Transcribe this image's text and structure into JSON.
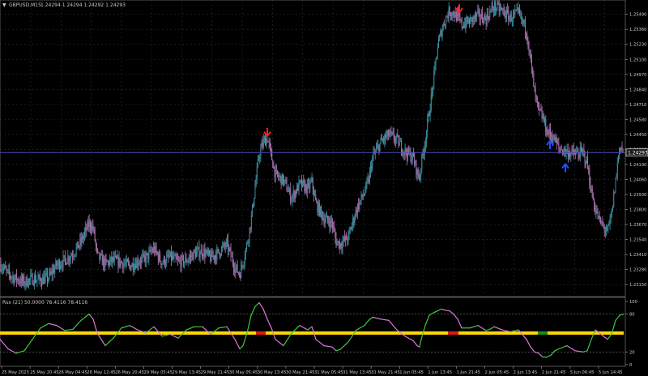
{
  "main": {
    "title_marker": "▼",
    "symbol": "GBPUSD,M15",
    "ohlc": "1.24294 1.24294 1.24292 1.24293",
    "current_price": "1.24293",
    "price_labels": [
      "1.25490",
      "1.25360",
      "1.25230",
      "1.25100",
      "1.24970",
      "1.24840",
      "1.24710",
      "1.24580",
      "1.24450",
      "1.24320",
      "1.24190",
      "1.24060",
      "1.23930",
      "1.23800",
      "1.23670",
      "1.23540",
      "1.23410",
      "1.23280",
      "1.23150"
    ]
  },
  "indicator": {
    "title": "Rsx (21) 50.0000 78.4116 78.4116",
    "levels": [
      "100",
      "80",
      "20",
      "0"
    ]
  },
  "time_axis": {
    "labels": [
      "25 May 2023",
      "25 May 20:45",
      "26 May 04:45",
      "26 May 12:45",
      "26 May 20:45",
      "29 May 05:45",
      "29 May 13:45",
      "29 May 21:45",
      "30 May 05:45",
      "30 May 13:45",
      "30 May 21:45",
      "31 May 05:45",
      "31 May 13:45",
      "31 May 21:45",
      "1 Jun 05:45",
      "1 Jun 13:45",
      "1 Jun 21:45",
      "2 Jun 05:45",
      "2 Jun 13:45",
      "2 Jun 21:45",
      "5 Jun 06:45",
      "5 Jun 14:45"
    ]
  },
  "colors": {
    "background": "#000000",
    "grid": "#2a2a3e",
    "bull_candle": "#3a8c9c",
    "bear_candle": "#a870a8",
    "rsx_up": "#3ec83e",
    "rsx_down": "#d87ad8",
    "midline": "#ffd700",
    "sell_arrow": "#ff2020",
    "buy_arrow": "#1e50ff",
    "current_price_line": "#4a4ab8"
  },
  "chart_data": {
    "type": "line",
    "symbol": "GBPUSD",
    "timeframe": "M15",
    "y_range": [
      1.2306,
      1.256
    ],
    "close_path": [
      [
        0,
        1.2333
      ],
      [
        10,
        1.2324
      ],
      [
        20,
        1.232
      ],
      [
        30,
        1.2317
      ],
      [
        40,
        1.232
      ],
      [
        50,
        1.2319
      ],
      [
        60,
        1.2321
      ],
      [
        70,
        1.2332
      ],
      [
        80,
        1.2336
      ],
      [
        90,
        1.2342
      ],
      [
        100,
        1.2352
      ],
      [
        110,
        1.2368
      ],
      [
        115,
        1.2364
      ],
      [
        120,
        1.234
      ],
      [
        130,
        1.2333
      ],
      [
        140,
        1.2336
      ],
      [
        150,
        1.2334
      ],
      [
        160,
        1.2331
      ],
      [
        170,
        1.2335
      ],
      [
        180,
        1.2338
      ],
      [
        190,
        1.2346
      ],
      [
        200,
        1.2334
      ],
      [
        210,
        1.2339
      ],
      [
        220,
        1.2334
      ],
      [
        230,
        1.2336
      ],
      [
        240,
        1.2342
      ],
      [
        250,
        1.2344
      ],
      [
        260,
        1.2338
      ],
      [
        270,
        1.2343
      ],
      [
        280,
        1.235
      ],
      [
        290,
        1.233
      ],
      [
        296,
        1.2324
      ],
      [
        300,
        1.2335
      ],
      [
        305,
        1.235
      ],
      [
        310,
        1.2371
      ],
      [
        315,
        1.24
      ],
      [
        320,
        1.2428
      ],
      [
        325,
        1.2438
      ],
      [
        330,
        1.2442
      ],
      [
        335,
        1.2426
      ],
      [
        340,
        1.241
      ],
      [
        350,
        1.2405
      ],
      [
        360,
        1.239
      ],
      [
        370,
        1.2402
      ],
      [
        380,
        1.2398
      ],
      [
        385,
        1.2404
      ],
      [
        390,
        1.2385
      ],
      [
        400,
        1.2372
      ],
      [
        410,
        1.2368
      ],
      [
        415,
        1.2352
      ],
      [
        420,
        1.235
      ],
      [
        430,
        1.2356
      ],
      [
        440,
        1.238
      ],
      [
        450,
        1.2395
      ],
      [
        455,
        1.2405
      ],
      [
        460,
        1.2425
      ],
      [
        470,
        1.2438
      ],
      [
        480,
        1.2445
      ],
      [
        490,
        1.244
      ],
      [
        500,
        1.243
      ],
      [
        510,
        1.2425
      ],
      [
        515,
        1.2412
      ],
      [
        518,
        1.2407
      ],
      [
        520,
        1.242
      ],
      [
        525,
        1.244
      ],
      [
        530,
        1.2465
      ],
      [
        535,
        1.249
      ],
      [
        540,
        1.252
      ],
      [
        545,
        1.2535
      ],
      [
        550,
        1.2545
      ],
      [
        555,
        1.2552
      ],
      [
        560,
        1.255
      ],
      [
        565,
        1.2546
      ],
      [
        570,
        1.254
      ],
      [
        580,
        1.2543
      ],
      [
        590,
        1.2548
      ],
      [
        600,
        1.2545
      ],
      [
        605,
        1.2551
      ],
      [
        610,
        1.2556
      ],
      [
        620,
        1.2552
      ],
      [
        630,
        1.2546
      ],
      [
        640,
        1.255
      ],
      [
        650,
        1.2535
      ],
      [
        655,
        1.251
      ],
      [
        660,
        1.248
      ],
      [
        665,
        1.2465
      ],
      [
        670,
        1.246
      ],
      [
        675,
        1.2448
      ],
      [
        680,
        1.2445
      ],
      [
        685,
        1.244
      ],
      [
        690,
        1.2433
      ],
      [
        700,
        1.243
      ],
      [
        710,
        1.2428
      ],
      [
        720,
        1.2429
      ],
      [
        725,
        1.242
      ],
      [
        730,
        1.2395
      ],
      [
        735,
        1.238
      ],
      [
        740,
        1.237
      ],
      [
        745,
        1.2365
      ],
      [
        750,
        1.236
      ],
      [
        755,
        1.2375
      ],
      [
        760,
        1.2405
      ],
      [
        765,
        1.2436
      ],
      [
        770,
        1.243
      ]
    ],
    "rsx_path": [
      [
        0,
        40
      ],
      [
        10,
        25
      ],
      [
        20,
        18
      ],
      [
        30,
        22
      ],
      [
        40,
        40
      ],
      [
        50,
        58
      ],
      [
        60,
        65
      ],
      [
        70,
        62
      ],
      [
        80,
        54
      ],
      [
        90,
        56
      ],
      [
        100,
        70
      ],
      [
        110,
        80
      ],
      [
        115,
        72
      ],
      [
        120,
        50
      ],
      [
        130,
        30
      ],
      [
        140,
        42
      ],
      [
        150,
        58
      ],
      [
        160,
        62
      ],
      [
        170,
        55
      ],
      [
        180,
        50
      ],
      [
        190,
        60
      ],
      [
        200,
        45
      ],
      [
        210,
        48
      ],
      [
        220,
        42
      ],
      [
        230,
        55
      ],
      [
        240,
        60
      ],
      [
        250,
        60
      ],
      [
        260,
        48
      ],
      [
        270,
        58
      ],
      [
        280,
        60
      ],
      [
        290,
        40
      ],
      [
        296,
        25
      ],
      [
        300,
        30
      ],
      [
        305,
        50
      ],
      [
        310,
        78
      ],
      [
        315,
        92
      ],
      [
        320,
        98
      ],
      [
        325,
        88
      ],
      [
        330,
        72
      ],
      [
        335,
        58
      ],
      [
        340,
        40
      ],
      [
        350,
        30
      ],
      [
        360,
        50
      ],
      [
        370,
        62
      ],
      [
        380,
        55
      ],
      [
        385,
        60
      ],
      [
        390,
        40
      ],
      [
        400,
        30
      ],
      [
        410,
        28
      ],
      [
        415,
        22
      ],
      [
        420,
        24
      ],
      [
        430,
        36
      ],
      [
        440,
        55
      ],
      [
        450,
        62
      ],
      [
        455,
        70
      ],
      [
        460,
        75
      ],
      [
        470,
        72
      ],
      [
        480,
        70
      ],
      [
        490,
        55
      ],
      [
        500,
        45
      ],
      [
        510,
        38
      ],
      [
        515,
        30
      ],
      [
        518,
        28
      ],
      [
        520,
        40
      ],
      [
        525,
        62
      ],
      [
        530,
        78
      ],
      [
        535,
        82
      ],
      [
        540,
        85
      ],
      [
        545,
        88
      ],
      [
        550,
        86
      ],
      [
        555,
        85
      ],
      [
        560,
        80
      ],
      [
        565,
        72
      ],
      [
        570,
        58
      ],
      [
        580,
        58
      ],
      [
        590,
        62
      ],
      [
        600,
        54
      ],
      [
        605,
        56
      ],
      [
        610,
        60
      ],
      [
        620,
        55
      ],
      [
        630,
        52
      ],
      [
        640,
        55
      ],
      [
        650,
        40
      ],
      [
        655,
        28
      ],
      [
        660,
        20
      ],
      [
        665,
        18
      ],
      [
        670,
        12
      ],
      [
        675,
        12
      ],
      [
        680,
        15
      ],
      [
        685,
        22
      ],
      [
        690,
        25
      ],
      [
        700,
        30
      ],
      [
        710,
        22
      ],
      [
        720,
        20
      ],
      [
        725,
        22
      ],
      [
        730,
        40
      ],
      [
        735,
        55
      ],
      [
        740,
        50
      ],
      [
        745,
        45
      ],
      [
        750,
        40
      ],
      [
        755,
        48
      ],
      [
        760,
        70
      ],
      [
        765,
        78
      ],
      [
        770,
        80
      ]
    ],
    "signals": [
      {
        "type": "sell",
        "x": 330,
        "price": 1.2443
      },
      {
        "type": "sell",
        "x": 567,
        "price": 1.255
      },
      {
        "type": "buy",
        "x": 679,
        "price": 1.244
      },
      {
        "type": "buy",
        "x": 698,
        "price": 1.242
      }
    ],
    "midline_segments": [
      {
        "from": 0,
        "to": 316,
        "color": "#ffd700"
      },
      {
        "from": 316,
        "to": 328,
        "color": "#e01818"
      },
      {
        "from": 328,
        "to": 553,
        "color": "#ffd700"
      },
      {
        "from": 553,
        "to": 566,
        "color": "#e01818"
      },
      {
        "from": 566,
        "to": 664,
        "color": "#ffd700"
      },
      {
        "from": 664,
        "to": 676,
        "color": "#1a8c1a"
      },
      {
        "from": 676,
        "to": 770,
        "color": "#ffd700"
      }
    ]
  }
}
